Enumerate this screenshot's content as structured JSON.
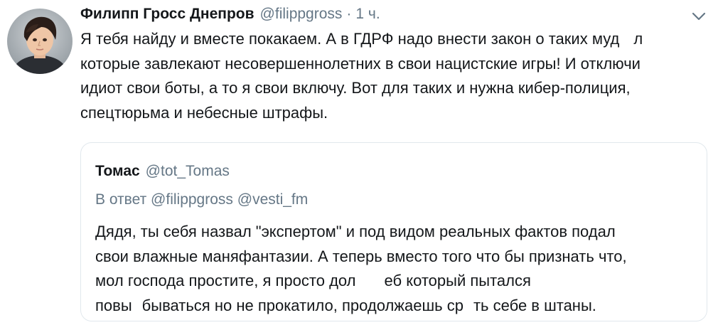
{
  "tweet": {
    "author_name": "Филипп Гросс Днепров",
    "author_handle": "@filippgross",
    "separator": "·",
    "time": "1 ч.",
    "avatar_icon": "avatar-cartoon-portrait",
    "caret_icon": "chevron-down-icon",
    "text_lines": [
      [
        "Я тебя найду и вместе покакаем. А в ГДРФ надо внести закон о таких муд",
        "л"
      ],
      [
        "которые завлекают несовершеннолетних в свои нацистские игры! И отключи"
      ],
      [
        "идиот свои боты, а то я свои включу. Вот для таких и нужна кибер-полиция,"
      ],
      [
        "спецтюрьма и небесные штрафы."
      ]
    ]
  },
  "quote": {
    "author_name": "Томас",
    "author_handle": "@tot_Tomas",
    "reply_prefix": "В ответ",
    "reply_mentions": [
      "@filippgross",
      "@vesti_fm"
    ],
    "text_lines": [
      [
        "Дядя, ты себя назвал \"экспертом\" и под видом реальных фактов подал"
      ],
      [
        "свои влажные маняфантазии. А теперь вместо того что бы признать что,"
      ],
      [
        "мол господа простите, я просто дол",
        "еб который пытался"
      ],
      [
        "повы",
        "бываться но не прокатило, продолжаешь ср",
        "ть себе в штаны."
      ]
    ]
  },
  "colors": {
    "text": "#14171a",
    "secondary": "#657786",
    "border": "#e1e8ed"
  }
}
